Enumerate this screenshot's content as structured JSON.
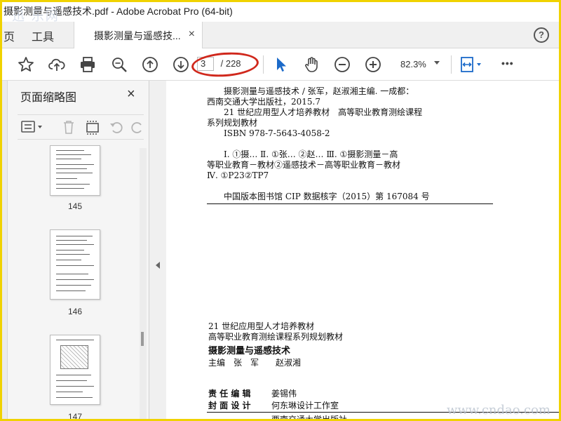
{
  "window": {
    "title": "摄影测量与遥感技术.pdf - Adobe Acrobat Pro (64-bit)",
    "watermark_top": "迅 乐网"
  },
  "menubar": {
    "home_label": "页",
    "tools_label": "工具",
    "doc_tab_label": "摄影测量与遥感技...",
    "doc_tab_close": "×",
    "help_label": "?"
  },
  "toolbar": {
    "icons": [
      "bookmark-star-icon",
      "cloud-upload-icon",
      "print-icon",
      "zoom-search-icon",
      "page-up-icon",
      "page-down-icon",
      "select-cursor-icon",
      "hand-tool-icon",
      "zoom-out-icon",
      "zoom-in-icon",
      "fit-page-icon",
      "more-icon"
    ],
    "current_page": "3",
    "total_pages": "/ 228",
    "zoom_level": "82.3%",
    "more_label": "•••"
  },
  "sidebar": {
    "title": "页面缩略图",
    "close_label": "×",
    "thumbnails": [
      {
        "page": "145"
      },
      {
        "page": "146"
      },
      {
        "page": "147"
      }
    ]
  },
  "document": {
    "cip_lines": [
      "　　摄影测量与遥感技术 / 张军，赵淑湘主编. 一成都：",
      "西南交通大学出版社，2015.7",
      "　　21 世纪应用型人才培养教材　高等职业教育测绘课程",
      "系列规划教材",
      "　　ISBN 978-7-5643-4058-2",
      "",
      "　　Ⅰ. ①摄…  Ⅱ. ①张…  ②赵…  Ⅲ. ①摄影测量－高",
      "等职业教育－教材②遥感技术－高等职业教育－教材",
      "Ⅳ. ①P23②TP7",
      "",
      "　　中国版本图书馆 CIP 数据核字（2015）第 167084 号"
    ],
    "series_line1": "21 世纪应用型人才培养教材",
    "series_line2": "高等职业教育测绘课程系列规划教材",
    "book_title": "摄影测量与遥感技术",
    "editors": "主编　张　军　　赵淑湘",
    "responsible_editor_label": "责 任 编 辑",
    "responsible_editor": "姜锡伟",
    "cover_design_label": "封 面 设 计",
    "cover_designer": "何东琳设计工作室",
    "publisher_partial": "西南交通大学出版社",
    "watermark_bottom": "www.cndao.com"
  },
  "colors": {
    "frame_border": "#f0d200",
    "annotation_red": "#d0281c",
    "select_tool_blue": "#1b6ac9"
  }
}
